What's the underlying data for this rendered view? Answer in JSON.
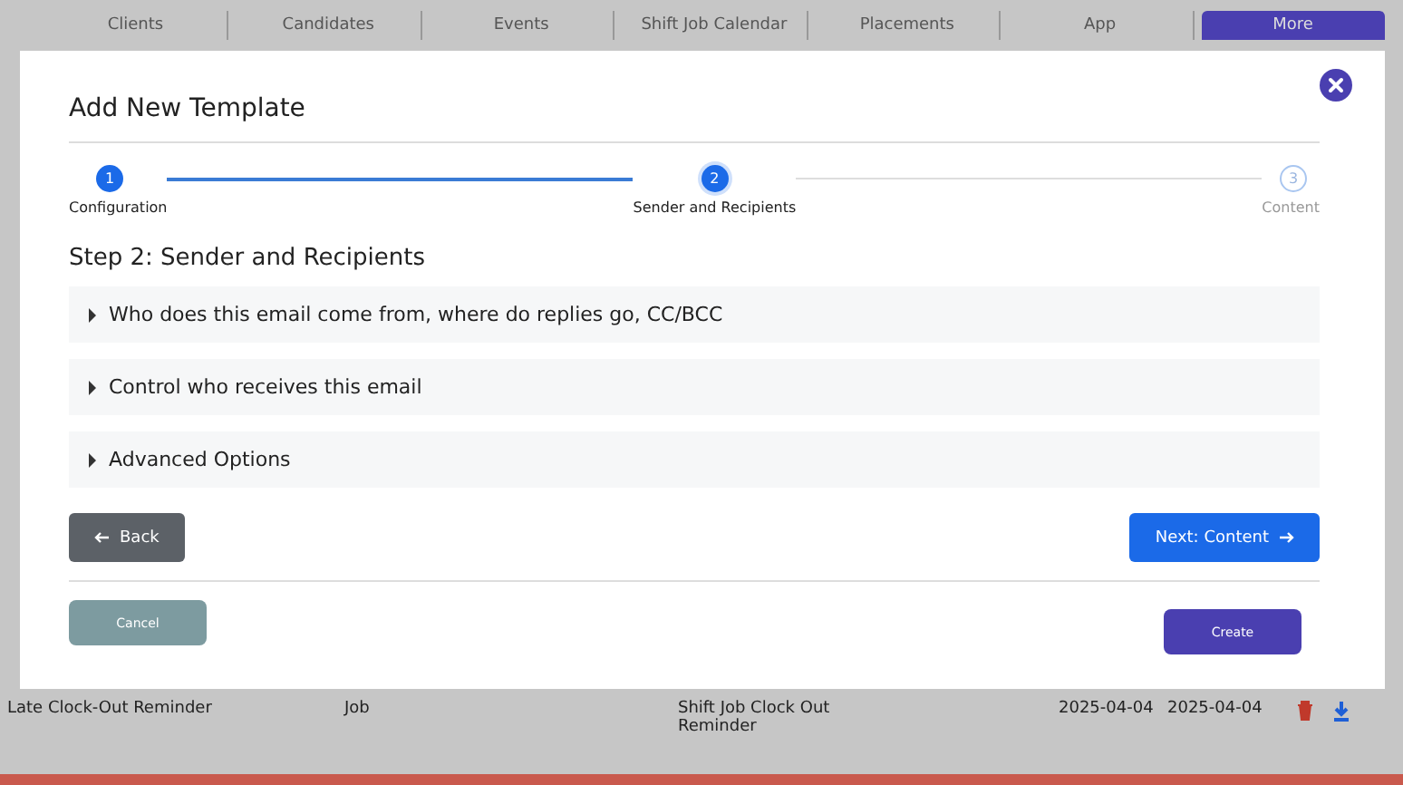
{
  "nav_tabs": [
    {
      "label": "Clients",
      "selected": false
    },
    {
      "label": "Candidates",
      "selected": false
    },
    {
      "label": "Events",
      "selected": false
    },
    {
      "label": "Shift Job Calendar",
      "selected": false
    },
    {
      "label": "Placements",
      "selected": false
    },
    {
      "label": "App",
      "selected": false
    },
    {
      "label": "More",
      "selected": true
    }
  ],
  "modal": {
    "title": "Add New Template",
    "steps": [
      {
        "number": "1",
        "label": "Configuration",
        "reached": true,
        "selected": false
      },
      {
        "number": "2",
        "label": "Sender and Recipients",
        "reached": true,
        "selected": true
      },
      {
        "number": "3",
        "label": "Content",
        "reached": false,
        "selected": false
      }
    ],
    "step_heading": "Step 2: Sender and Recipients",
    "sections": [
      {
        "label": "Who does this email come from, where do replies go, CC/BCC",
        "expanded": false
      },
      {
        "label": "Control who receives this email",
        "expanded": false
      },
      {
        "label": "Advanced Options",
        "expanded": false
      }
    ],
    "back_button": "Back",
    "next_button": "Next: Content",
    "cancel_button": "Cancel",
    "create_button": "Create"
  },
  "table_row": {
    "name": "Late Clock-Out Reminder",
    "type": "Job",
    "template": "Shift Job Clock Out Reminder",
    "created": "2025-04-04",
    "updated": "2025-04-04"
  }
}
